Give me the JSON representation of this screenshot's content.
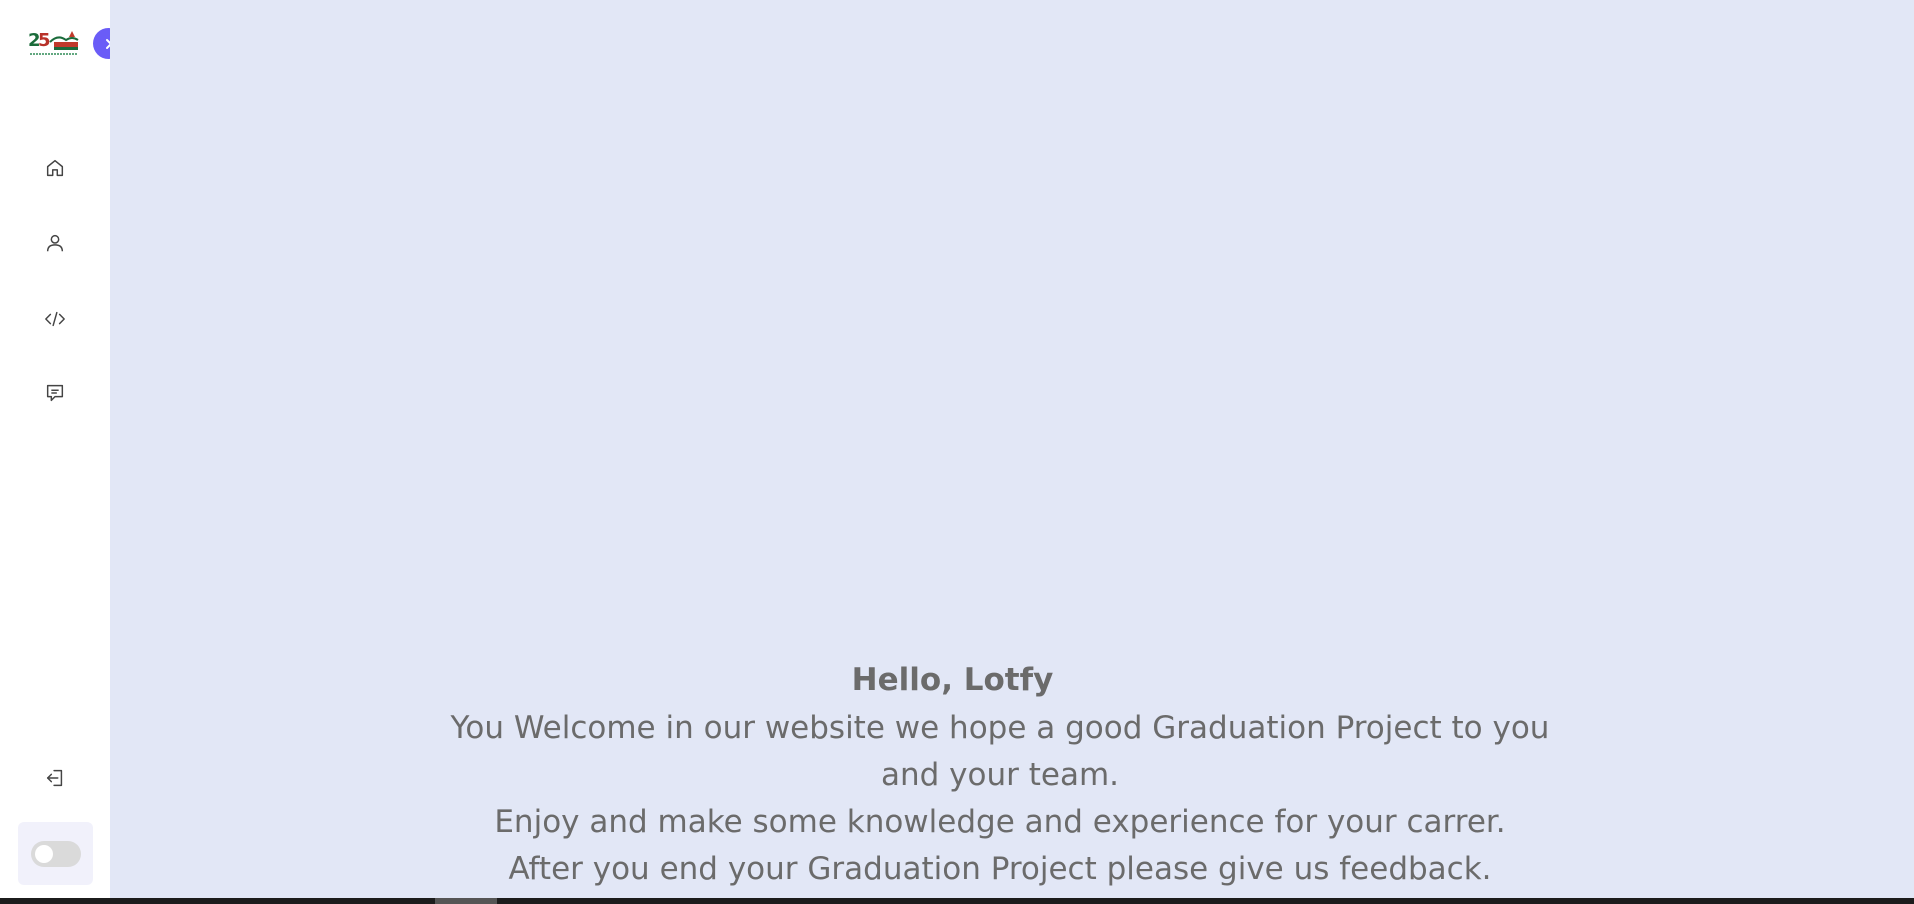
{
  "sidebar": {
    "logo_alt": "25",
    "items": [
      {
        "name": "home",
        "icon": "home-icon"
      },
      {
        "name": "profile",
        "icon": "user-icon"
      },
      {
        "name": "projects",
        "icon": "code-icon"
      },
      {
        "name": "feedback",
        "icon": "message-icon"
      }
    ],
    "logout_icon": "logout-icon",
    "toggle_icon": "chevron-right-icon",
    "theme_switch": {
      "state": "off"
    },
    "accent_color": "#6a5cf7"
  },
  "main": {
    "background": "#e2e7f6",
    "greeting": "Hello, Lotfy",
    "lines": [
      "You Welcome in our website we hope a good Graduation Project to you",
      "and your team.",
      "Enjoy and make some knowledge and experience for your carrer.",
      "After you end your Graduation Project please give us feedback."
    ]
  }
}
